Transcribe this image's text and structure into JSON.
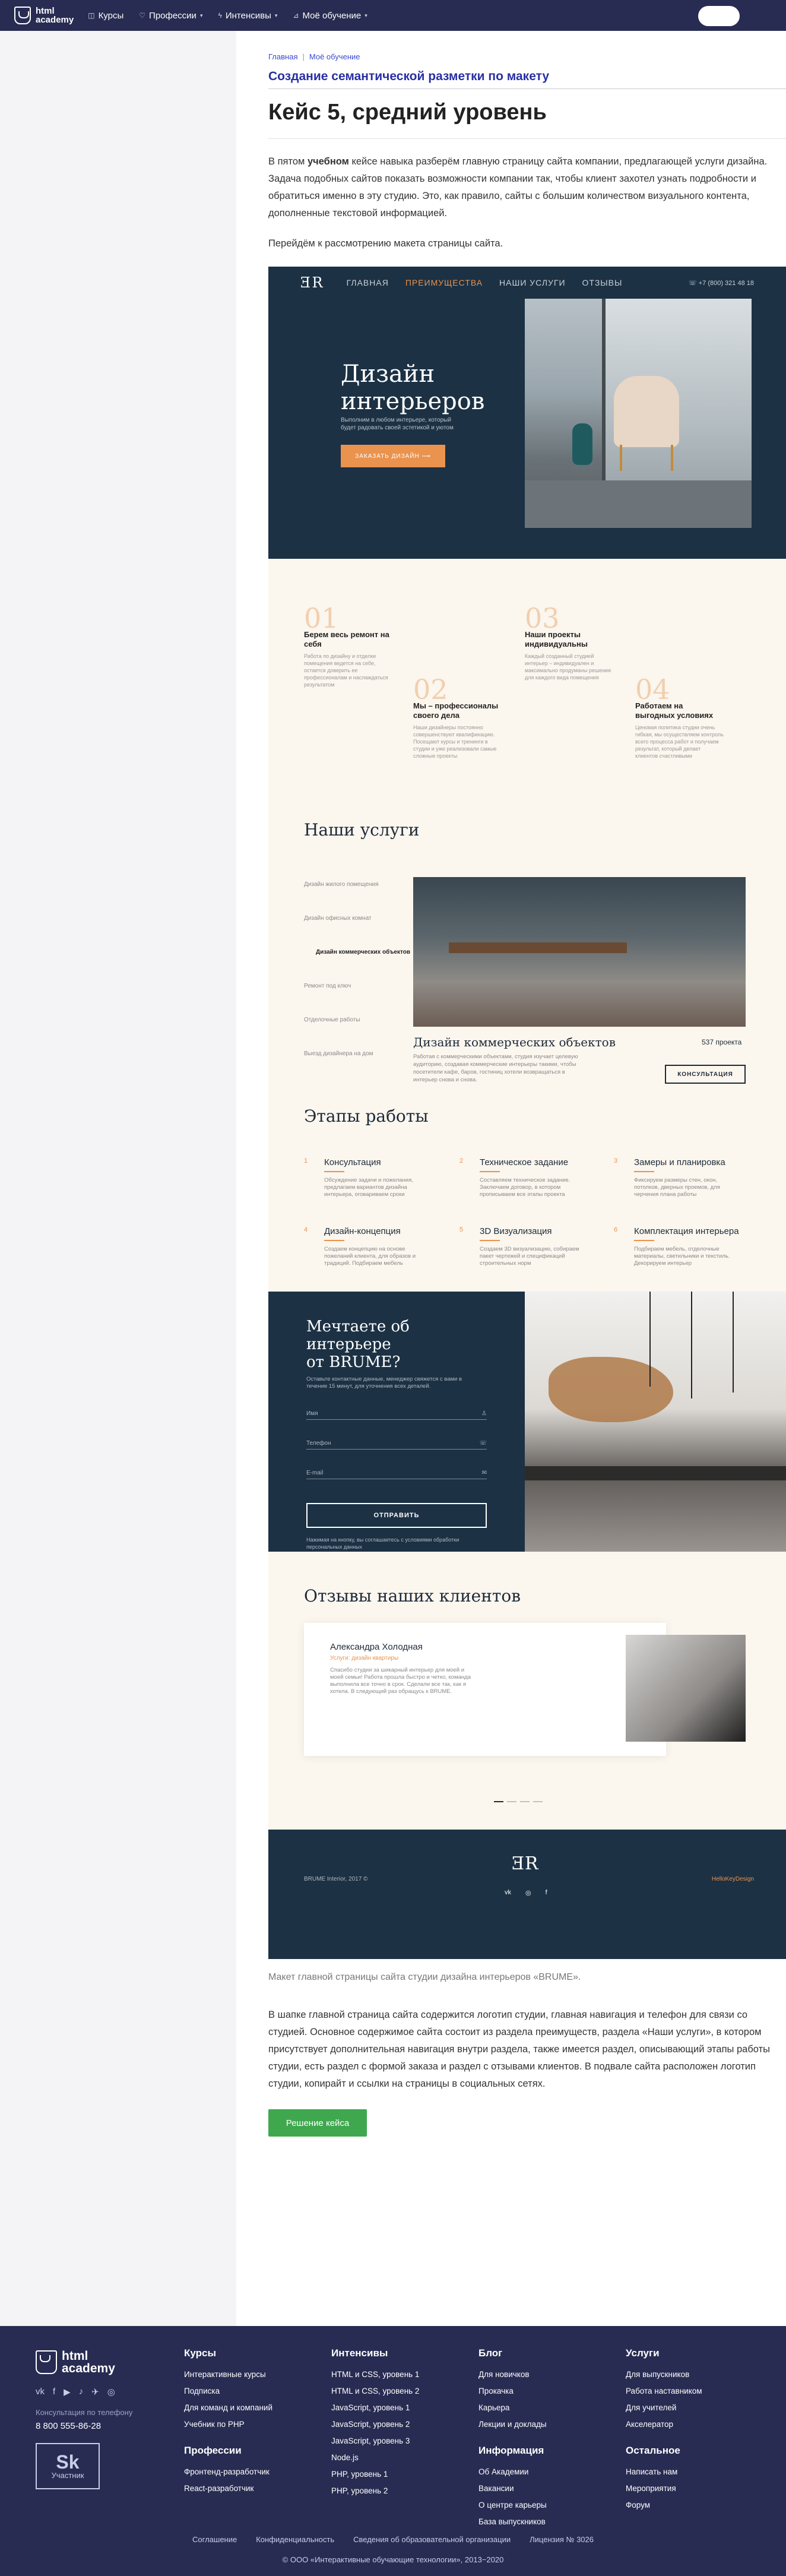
{
  "header": {
    "logo_line1": "html",
    "logo_line2": "academy",
    "nav": [
      {
        "label": "Курсы",
        "icon": "grid-icon",
        "glyph": "◫",
        "caret": false
      },
      {
        "label": "Профессии",
        "icon": "heart-icon",
        "glyph": "♡",
        "caret": true
      },
      {
        "label": "Интенсивы",
        "icon": "bolt-icon",
        "glyph": "ϟ",
        "caret": true
      },
      {
        "label": "Моё обучение",
        "icon": "chart-icon",
        "glyph": "⊿",
        "caret": true
      }
    ]
  },
  "breadcrumbs": [
    "Главная",
    "Моё обучение"
  ],
  "section_title": "Создание семантической разметки по макету",
  "page_title": "Кейс 5, средний уровень",
  "intro": {
    "p1_pre": "В пятом ",
    "p1_bold": "учебном",
    "p1_post": " кейсе навыка разберём главную страницу сайта компании, предлагающей услуги дизайна. Задача подобных сайтов показать возможности компании так, чтобы клиент захотел узнать подробности и обратиться именно в эту студию. Это, как правило, сайты с большим количеством визуального контента, дополненные текстовой информацией.",
    "p2": "Перейдём к рассмотрению макета страницы сайта."
  },
  "mockup": {
    "logo": "ƎR",
    "nav": [
      "ГЛАВНАЯ",
      "ПРЕИМУЩЕСТВА",
      "НАШИ УСЛУГИ",
      "ОТЗЫВЫ"
    ],
    "phone": "☏ +7 (800) 321 48 18",
    "hero_title_1": "Дизайн",
    "hero_title_2": "интерьеров",
    "hero_sub": "Выполним в любом интерьере, который будет радовать своей эстетикой и уютом",
    "hero_btn": "ЗАКАЗАТЬ ДИЗАЙН ⟶",
    "advantages": [
      {
        "num": "01",
        "title": "Берем весь ремонт на себя",
        "text": "Работа по дизайну и отделке помещения ведется на себе, остается доверить ее профессионалам и наслаждаться результатом"
      },
      {
        "num": "02",
        "title": "Мы – профессионалы своего дела",
        "text": "Наши дизайнеры постоянно совершенствуют квалификацию. Посещают курсы и тренинги в студии и уже реализовали самые сложные проекты"
      },
      {
        "num": "03",
        "title": "Наши проекты индивидуальны",
        "text": "Каждый созданный студией интерьер – индивидуален и максимально продуманы решения для каждого вида помещения"
      },
      {
        "num": "04",
        "title": "Работаем на выгодных условиях",
        "text": "Ценовая политика студии очень гибкая, мы осуществляем контроль всего процесса работ и получаем результат, который делает клиентов счастливыми"
      }
    ],
    "services_title": "Наши услуги",
    "services": [
      "Дизайн жилого помещения",
      "Дизайн офисных комнат",
      "Дизайн коммерческих объектов",
      "Ремонт под ключ",
      "Отделочные работы",
      "Выезд дизайнера на дом"
    ],
    "service_name": "Дизайн коммерческих объектов",
    "service_count": "537 проекта",
    "service_desc": "Работая с коммерческими объектами, студия изучает целевую аудиторию, создавая коммерческие интерьеры такими, чтобы посетители кафе, баров, гостиниц хотели возвращаться в интерьер снова и снова.",
    "service_btn": "КОНСУЛЬТАЦИЯ",
    "stages_title": "Этапы работы",
    "stages": [
      {
        "num": "1",
        "title": "Консультация",
        "text": "Обсуждение задачи и пожелания, предлагаем вариантов дизайна интерьера, оговариваем сроки"
      },
      {
        "num": "2",
        "title": "Техническое задание",
        "text": "Составляем техническое задание. Заключаем договор, в котором прописываем все этапы проекта"
      },
      {
        "num": "3",
        "title": "Замеры и планировка",
        "text": "Фиксируем размеры стен, окон, потолков, дверных проемов, для черчения плана работы"
      },
      {
        "num": "4",
        "title": "Дизайн-концепция",
        "text": "Создаем концепцию на основе пожеланий клиента, для образов и традиций. Подбираем мебель"
      },
      {
        "num": "5",
        "title": "3D Визуализация",
        "text": "Создаем 3D визуализацию, собираем пакет чертежей и спецификаций строительных норм"
      },
      {
        "num": "6",
        "title": "Комплектация интерьера",
        "text": "Подбираем мебель, отделочные материалы, светильники и текстиль. Декорируем интерьер"
      }
    ],
    "form_title_1": "Мечтаете об интерьере",
    "form_title_2": "от BRUME?",
    "form_sub": "Оставьте контактные данные, менеджер свяжется с вами в течение 15 минут, для уточнения всех деталей.",
    "form_fields": [
      {
        "label": "Имя",
        "icon": "user-icon",
        "glyph": "♙"
      },
      {
        "label": "Телефон",
        "icon": "phone-icon",
        "glyph": "☏"
      },
      {
        "label": "E-mail",
        "icon": "mail-icon",
        "glyph": "✉"
      }
    ],
    "form_btn": "ОТПРАВИТЬ",
    "form_note": "Нажимая на кнопку, вы соглашаетесь с условиями обработки персональных данных",
    "reviews_title": "Отзывы наших клиентов",
    "review_name": "Александра Холодная",
    "review_role": "Услуги: дизайн квартиры",
    "review_text": "Спасибо студии за шикарный интерьер для моей и моей семьи! Работа прошла быстро и четко, команда выполнила все точно в срок. Сделали все так, как я хотела. В следующий раз обращусь к BRUME.",
    "footer_logo": "ƎR",
    "footer_copy": "BRUME Interior, 2017 ©",
    "footer_dev": "HelloKeyDesign",
    "footer_social": [
      "vk",
      "◎",
      "f"
    ]
  },
  "caption": "Макет главной страницы сайта студии дизайна интерьеров «BRUME».",
  "outro": "В шапке главной страница сайта содержится логотип студии, главная навигация и телефон для связи со студией. Основное содержимое сайта состоит из раздела преимуществ, раздела «Наши услуги», в котором присутствует дополнительная навигация внутри раздела, также имеется раздел, описывающий этапы работы студии, есть раздел с формой заказа и раздел с отзывами клиентов. В подвале сайта расположен логотип студии, копирайт и ссылки на страницы в социальных сетях.",
  "solution_btn": "Решение кейса",
  "footer": {
    "logo_line1": "html",
    "logo_line2": "academy",
    "social": [
      "vk",
      "f",
      "▶",
      "♪",
      "✈",
      "◎"
    ],
    "phone_label": "Консультация по телефону",
    "phone": "8 800 555-86-28",
    "badge_big": "Sk",
    "badge_small": "Участник",
    "col1_title": "Курсы",
    "col1_links": [
      "Интерактивные курсы",
      "Подписка",
      "Для команд и компаний",
      "Учебник по PHP"
    ],
    "col1b_title": "Профессии",
    "col1b_links": [
      "Фронтенд-разработчик",
      "React-разработчик"
    ],
    "col2_title": "Интенсивы",
    "col2_links": [
      "HTML и CSS, уровень 1",
      "HTML и CSS, уровень 2",
      "JavaScript, уровень 1",
      "JavaScript, уровень 2",
      "JavaScript, уровень 3",
      "Node.js",
      "PHP, уровень 1",
      "PHP, уровень 2"
    ],
    "col3_title": "Блог",
    "col3_links": [
      "Для новичков",
      "Прокачка",
      "Карьера",
      "Лекции и доклады"
    ],
    "col3b_title": "Информация",
    "col3b_links": [
      "Об Академии",
      "Вакансии",
      "О центре карьеры",
      "База выпускников"
    ],
    "col4_title": "Услуги",
    "col4_links": [
      "Для выпускников",
      "Работа наставником",
      "Для учителей",
      "Акселератор"
    ],
    "col4b_title": "Остальное",
    "col4b_links": [
      "Написать нам",
      "Мероприятия",
      "Форум"
    ],
    "bottom_links": [
      "Соглашение",
      "Конфиденциальность",
      "Сведения об образовательной организации",
      "Лицензия № 3026"
    ],
    "copyright": "© ООО «Интерактивные обучающие технологии», 2013−2020"
  }
}
